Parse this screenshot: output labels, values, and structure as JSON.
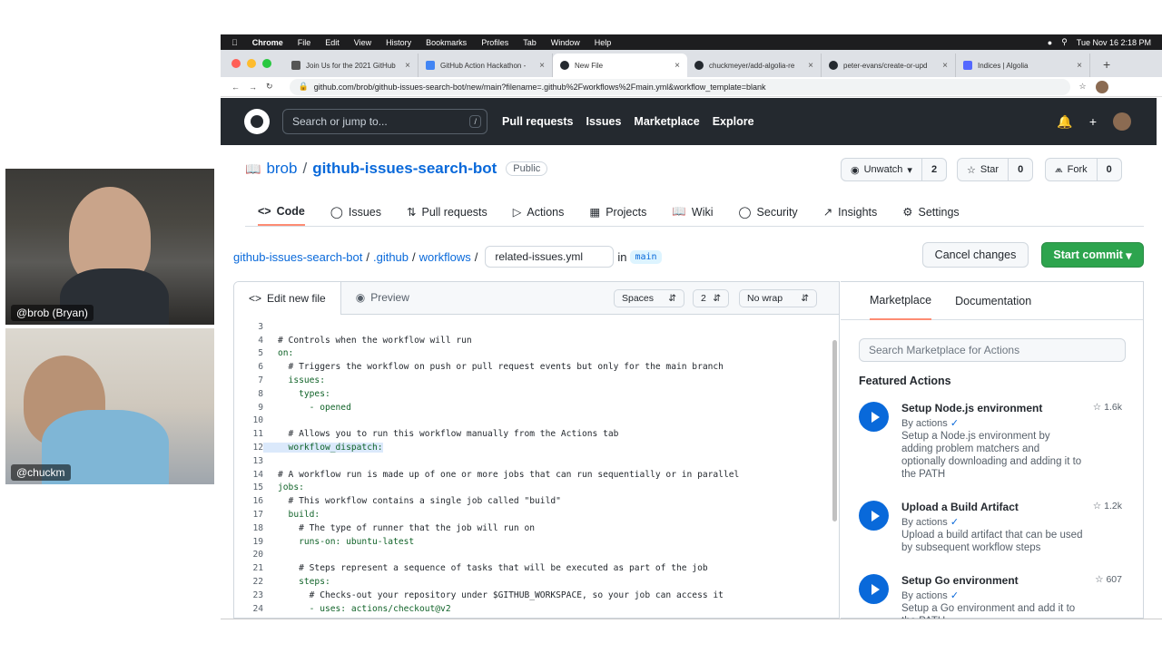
{
  "webcams": [
    {
      "label": "@brob (Bryan)"
    },
    {
      "label": "@chuckm"
    }
  ],
  "menubar": {
    "app": "Chrome",
    "items": [
      "File",
      "Edit",
      "View",
      "History",
      "Bookmarks",
      "Profiles",
      "Tab",
      "Window",
      "Help"
    ],
    "datetime": "Tue Nov 16  2:18 PM"
  },
  "tabs": [
    {
      "title": "Join Us for the 2021 GitHub",
      "favicon": "dev-icon"
    },
    {
      "title": "GitHub Action Hackathon -",
      "favicon": "doc-icon"
    },
    {
      "title": "New File",
      "favicon": "github-icon",
      "active": true
    },
    {
      "title": "chuckmeyer/add-algolia-re",
      "favicon": "github-icon"
    },
    {
      "title": "peter-evans/create-or-upd",
      "favicon": "github-icon"
    },
    {
      "title": "Indices | Algolia",
      "favicon": "algolia-icon"
    }
  ],
  "address": {
    "url": "github.com/brob/github-issues-search-bot/new/main?filename=.github%2Fworkflows%2Fmain.yml&workflow_template=blank"
  },
  "gh": {
    "search_placeholder": "Search or jump to...",
    "slash": "/",
    "nav": [
      "Pull requests",
      "Issues",
      "Marketplace",
      "Explore"
    ],
    "plus": "+"
  },
  "repo": {
    "owner": "brob",
    "sep": "/",
    "name": "github-issues-search-bot",
    "visibility": "Public",
    "unwatch": "Unwatch",
    "watch_count": "2",
    "star": "Star",
    "star_count": "0",
    "fork": "Fork",
    "fork_count": "0"
  },
  "repo_tabs": [
    "Code",
    "Issues",
    "Pull requests",
    "Actions",
    "Projects",
    "Wiki",
    "Security",
    "Insights",
    "Settings"
  ],
  "crumb": {
    "root": "github-issues-search-bot",
    "dir1": ".github",
    "dir2": "workflows",
    "sep": "/",
    "filename": "related-issues.yml",
    "in": "in",
    "branch": "main"
  },
  "buttons": {
    "cancel": "Cancel changes",
    "commit": "Start commit"
  },
  "editor": {
    "tab_edit": "Edit new file",
    "tab_preview": "Preview",
    "indent_mode": "Spaces",
    "indent_size": "2",
    "wrap": "No wrap"
  },
  "code": [
    {
      "n": "3",
      "t": ""
    },
    {
      "n": "4",
      "t": "# Controls when the workflow will run"
    },
    {
      "n": "5",
      "t": "on:"
    },
    {
      "n": "6",
      "t": "  # Triggers the workflow on push or pull request events but only for the main branch"
    },
    {
      "n": "7",
      "t": "  issues:"
    },
    {
      "n": "8",
      "t": "    types:"
    },
    {
      "n": "9",
      "t": "      - opened"
    },
    {
      "n": "10",
      "t": ""
    },
    {
      "n": "11",
      "t": "  # Allows you to run this workflow manually from the Actions tab"
    },
    {
      "n": "12",
      "t": "  workflow_dispatch:",
      "hl": true
    },
    {
      "n": "13",
      "t": ""
    },
    {
      "n": "14",
      "t": "# A workflow run is made up of one or more jobs that can run sequentially or in parallel"
    },
    {
      "n": "15",
      "t": "jobs:"
    },
    {
      "n": "16",
      "t": "  # This workflow contains a single job called \"build\""
    },
    {
      "n": "17",
      "t": "  build:"
    },
    {
      "n": "18",
      "t": "    # The type of runner that the job will run on"
    },
    {
      "n": "19",
      "t": "    runs-on: ubuntu-latest"
    },
    {
      "n": "20",
      "t": ""
    },
    {
      "n": "21",
      "t": "    # Steps represent a sequence of tasks that will be executed as part of the job"
    },
    {
      "n": "22",
      "t": "    steps:"
    },
    {
      "n": "23",
      "t": "      # Checks-out your repository under $GITHUB_WORKSPACE, so your job can access it"
    },
    {
      "n": "24",
      "t": "      - uses: actions/checkout@v2"
    }
  ],
  "side": {
    "tab_marketplace": "Marketplace",
    "tab_docs": "Documentation",
    "search_placeholder": "Search Marketplace for Actions",
    "featured": "Featured Actions",
    "actions": [
      {
        "title": "Setup Node.js environment",
        "by": "By actions",
        "desc": "Setup a Node.js environment by adding problem matchers and optionally downloading and adding it to the PATH",
        "stars": "1.6k"
      },
      {
        "title": "Upload a Build Artifact",
        "by": "By actions",
        "desc": "Upload a build artifact that can be used by subsequent workflow steps",
        "stars": "1.2k"
      },
      {
        "title": "Setup Go environment",
        "by": "By actions",
        "desc": "Setup a Go environment and add it to the PATH",
        "stars": "607"
      }
    ]
  }
}
